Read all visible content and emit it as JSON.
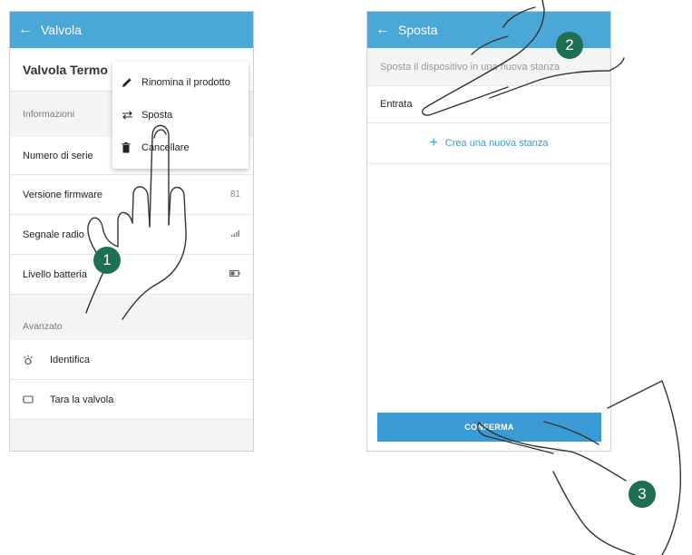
{
  "left_screen": {
    "appbar": {
      "back_icon": "arrow-left-icon",
      "title": "Valvola"
    },
    "device_name": "Valvola Termo",
    "info_header": "Informazioni",
    "rows": [
      {
        "label": "Numero di serie",
        "value": ""
      },
      {
        "label": "Versione firmware",
        "value": "81"
      },
      {
        "label": "Segnale radio",
        "value": "",
        "icon": "signal-icon"
      },
      {
        "label": "Livello batteria",
        "value": "",
        "icon": "battery-icon"
      }
    ],
    "advanced_header": "Avanzato",
    "actions": [
      {
        "label": "Identifica",
        "icon": "identify-icon"
      },
      {
        "label": "Tara la valvola",
        "icon": "valve-icon"
      }
    ],
    "menu": [
      {
        "label": "Rinomina il prodotto",
        "icon": "pencil-icon"
      },
      {
        "label": "Sposta",
        "icon": "swap-icon"
      },
      {
        "label": "Cancellare",
        "icon": "trash-icon"
      }
    ]
  },
  "right_screen": {
    "appbar": {
      "back_icon": "arrow-left-icon",
      "title": "Sposta"
    },
    "hint": "Sposta il dispositivo in una nuova stanza",
    "room": "Entrata",
    "create_room": "Crea una nuova stanza",
    "confirm": "CONFERMA"
  },
  "steps": [
    "1",
    "2",
    "3"
  ],
  "colors": {
    "appbar": "#4aa7d6",
    "accent": "#3a9ad4",
    "badge": "#1f6f52"
  }
}
